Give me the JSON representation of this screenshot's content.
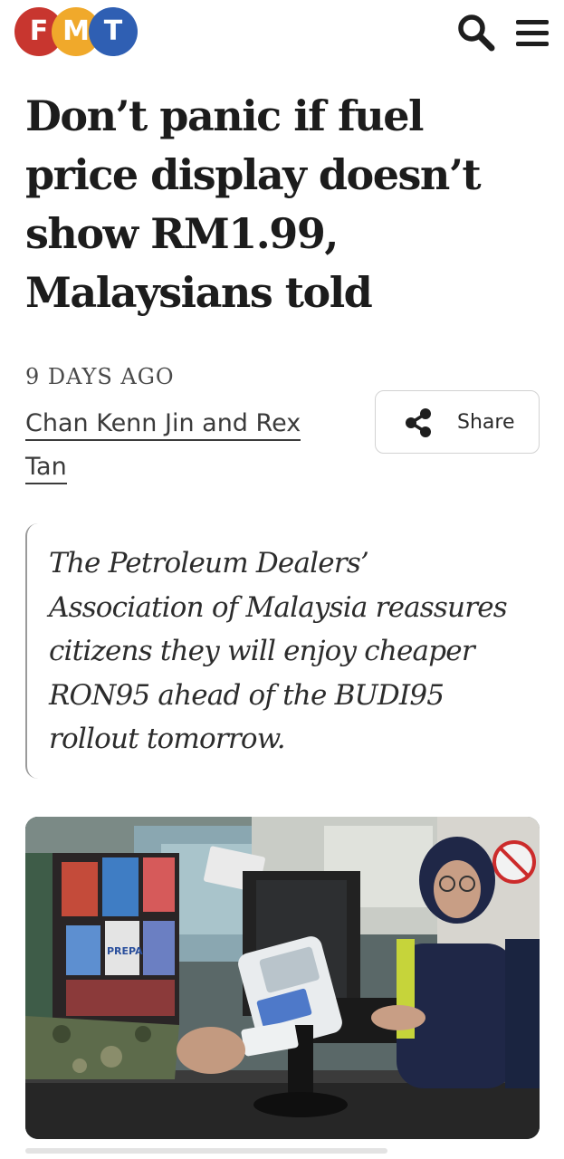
{
  "header": {
    "logo_letters": [
      "F",
      "M",
      "T"
    ],
    "logo_colors": [
      "#c8362f",
      "#f0a92b",
      "#2f5fb3"
    ],
    "search_icon": "search-icon",
    "menu_icon": "hamburger-menu-icon"
  },
  "article": {
    "headline_lines": [
      "Don’t panic if fuel",
      "price display doesn’t",
      "show RM1.99,",
      "Malaysians told"
    ],
    "date": "9 DAYS AGO",
    "author_line1": "Chan Kenn Jin and Rex",
    "author_line2": "Tan",
    "share_label": "Share",
    "share_icon": "share-icon",
    "quote_lines": [
      "The Petroleum Dealers’",
      "Association of Malaysia reassures",
      "citizens they will enjoy cheaper",
      "RON95 ahead of the BUDI95",
      "rollout tomorrow."
    ]
  },
  "photo": {
    "card_text": "PREPAID"
  }
}
